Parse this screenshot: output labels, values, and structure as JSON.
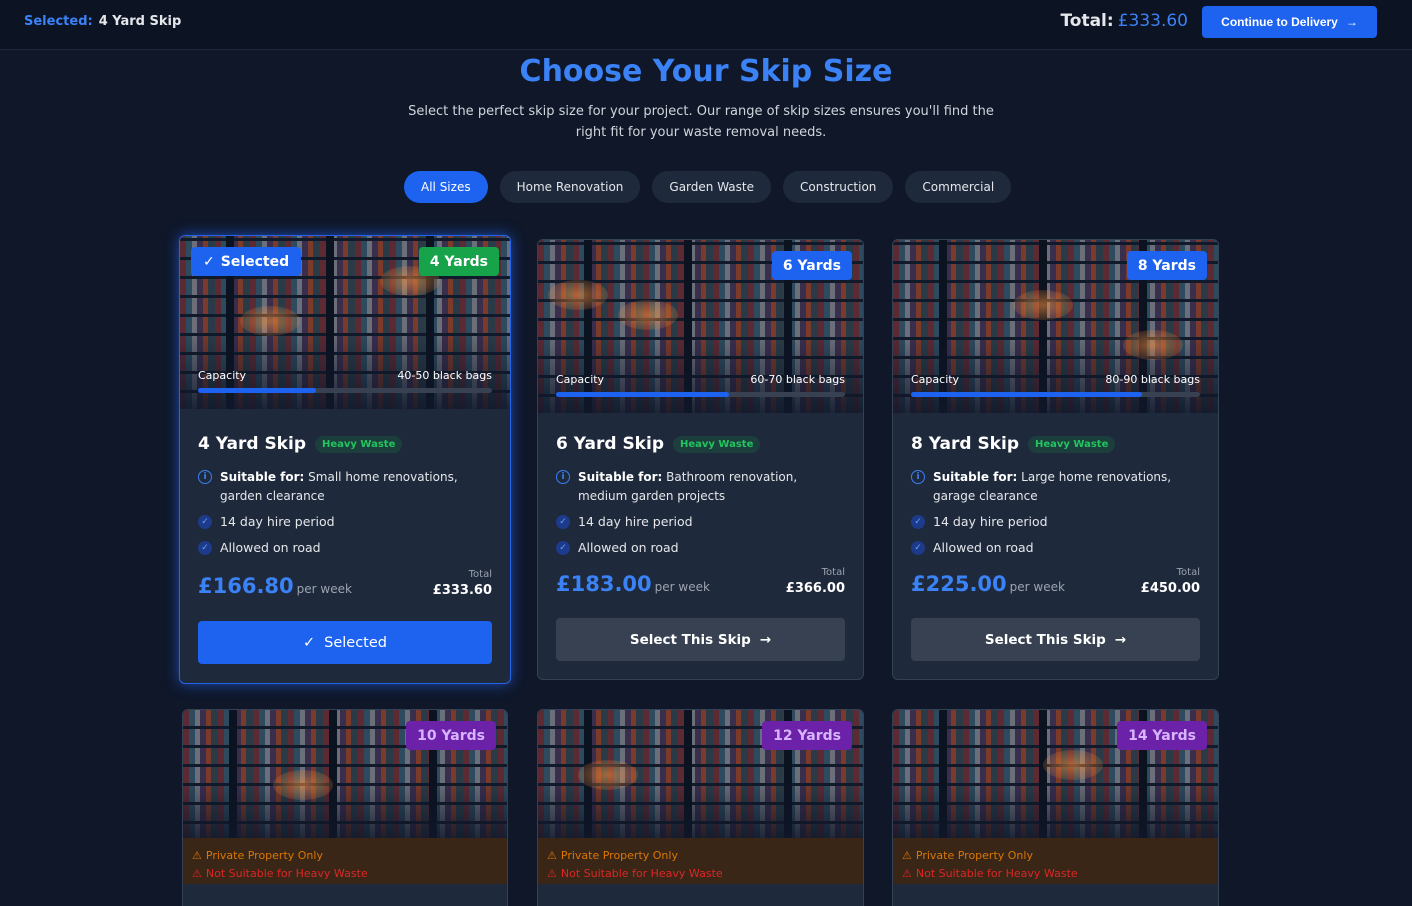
{
  "topbar": {
    "selected_label": "Selected:",
    "selected_value": "4 Yard Skip",
    "total_label": "Total:",
    "total_value": "£333.60",
    "continue_label": "Continue to Delivery"
  },
  "header": {
    "title": "Choose Your Skip Size",
    "subtitle": "Select the perfect skip size for your project. Our range of skip sizes ensures you'll find the right fit for your waste removal needs."
  },
  "filters": [
    "All Sizes",
    "Home Renovation",
    "Garden Waste",
    "Construction",
    "Commercial"
  ],
  "cards": [
    {
      "yards": "4 Yards",
      "badge_color": "#16a34a",
      "selected": true,
      "selected_badge": "Selected",
      "capacity_label": "Capacity",
      "capacity_value": "40-50 black bags",
      "capacity_fraction": 0.4,
      "name": "4 Yard Skip",
      "tag": "Heavy Waste",
      "suitable_label": "Suitable for:",
      "suitable_text": "Small home renovations, garden clearance",
      "features": [
        "14 day hire period",
        "Allowed on road"
      ],
      "price": "£166.80",
      "per": "per week",
      "total_label": "Total",
      "total": "£333.60",
      "cta": "Selected"
    },
    {
      "yards": "6 Yards",
      "badge_color": "#1d63f0",
      "selected": false,
      "capacity_label": "Capacity",
      "capacity_value": "60-70 black bags",
      "capacity_fraction": 0.6,
      "name": "6 Yard Skip",
      "tag": "Heavy Waste",
      "suitable_label": "Suitable for:",
      "suitable_text": "Bathroom renovation, medium garden projects",
      "features": [
        "14 day hire period",
        "Allowed on road"
      ],
      "price": "£183.00",
      "per": "per week",
      "total_label": "Total",
      "total": "£366.00",
      "cta": "Select This Skip"
    },
    {
      "yards": "8 Yards",
      "badge_color": "#1d63f0",
      "selected": false,
      "capacity_label": "Capacity",
      "capacity_value": "80-90 black bags",
      "capacity_fraction": 0.8,
      "name": "8 Yard Skip",
      "tag": "Heavy Waste",
      "suitable_label": "Suitable for:",
      "suitable_text": "Large home renovations, garage clearance",
      "features": [
        "14 day hire period",
        "Allowed on road"
      ],
      "price": "£225.00",
      "per": "per week",
      "total_label": "Total",
      "total": "£450.00",
      "cta": "Select This Skip"
    },
    {
      "yards": "10 Yards",
      "badge_color": "#6b21a8",
      "warnings": [
        "Private Property Only",
        "Not Suitable for Heavy Waste"
      ]
    },
    {
      "yards": "12 Yards",
      "badge_color": "#6b21a8",
      "warnings": [
        "Private Property Only",
        "Not Suitable for Heavy Waste"
      ]
    },
    {
      "yards": "14 Yards",
      "badge_color": "#6b21a8",
      "warnings": [
        "Private Property Only",
        "Not Suitable for Heavy Waste"
      ]
    }
  ]
}
